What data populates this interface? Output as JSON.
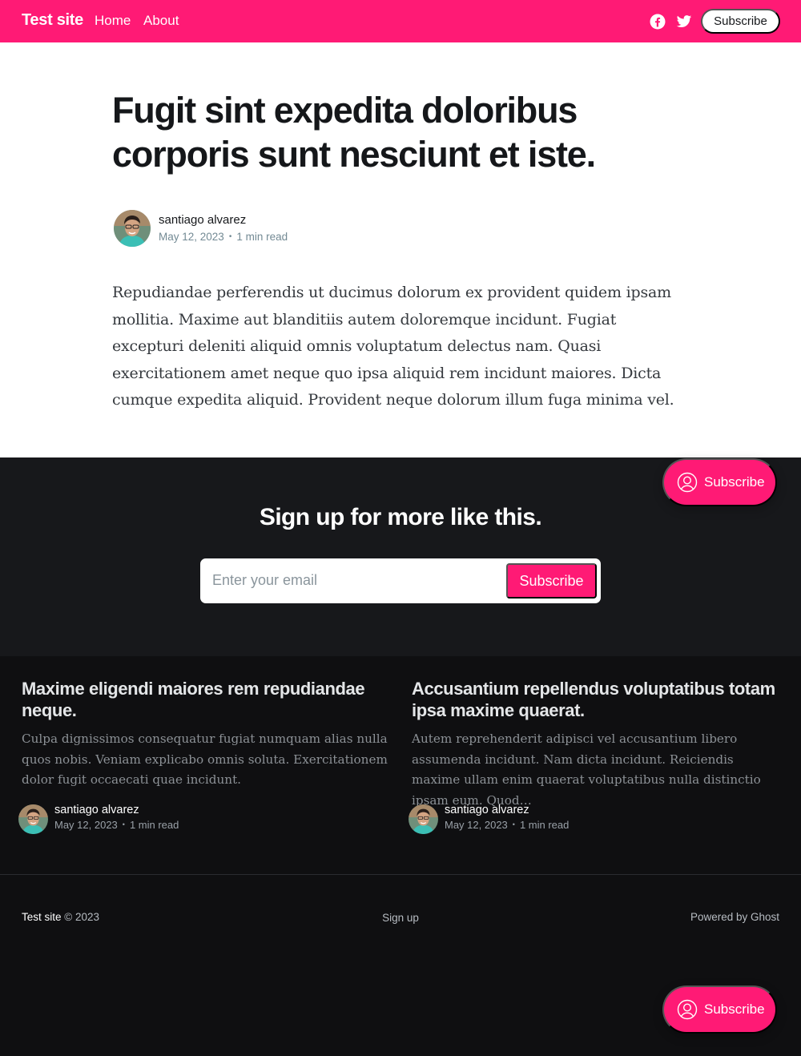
{
  "header": {
    "site_title": "Test site",
    "nav": [
      {
        "label": "Home"
      },
      {
        "label": "About"
      }
    ],
    "subscribe_label": "Subscribe",
    "accent_color": "#ff1a75"
  },
  "article": {
    "title": "Fugit sint expedita doloribus corporis sunt nesciunt et iste.",
    "author": "santiago alvarez",
    "date": "May 12, 2023",
    "read_time": "1 min read",
    "body": "Repudiandae perferendis ut ducimus dolorum ex provident quidem ipsam mollitia. Maxime aut blanditiis autem doloremque incidunt. Fugiat excepturi deleniti aliquid omnis voluptatum delectus nam. Quasi exercitationem amet neque quo ipsa aliquid rem incidunt maiores. Dicta cumque expedita aliquid. Provident neque dolorum illum fuga minima vel."
  },
  "signup": {
    "title": "Sign up for more like this.",
    "email_placeholder": "Enter your email",
    "button_label": "Subscribe"
  },
  "portal": {
    "label": "Subscribe"
  },
  "related": [
    {
      "title": "Maxime eligendi maiores rem repudiandae neque.",
      "excerpt": "Culpa dignissimos consequatur fugiat numquam alias nulla quos nobis. Veniam explicabo omnis soluta. Exercitationem dolor fugit occaecati quae incidunt.",
      "author": "santiago alvarez",
      "date": "May 12, 2023",
      "read_time": "1 min read"
    },
    {
      "title": "Accusantium repellendus voluptatibus totam ipsa maxime quaerat.",
      "excerpt": "Autem reprehenderit adipisci vel accusantium libero assumenda incidunt. Nam dicta incidunt. Reiciendis maxime ullam enim quaerat voluptatibus nulla distinctio ipsam eum. Quod…",
      "author": "santiago alvarez",
      "date": "May 12, 2023",
      "read_time": "1 min read"
    }
  ],
  "footer": {
    "brand": "Test site",
    "copyright": "© 2023",
    "signup_link": "Sign up",
    "powered_by": "Powered by Ghost"
  }
}
